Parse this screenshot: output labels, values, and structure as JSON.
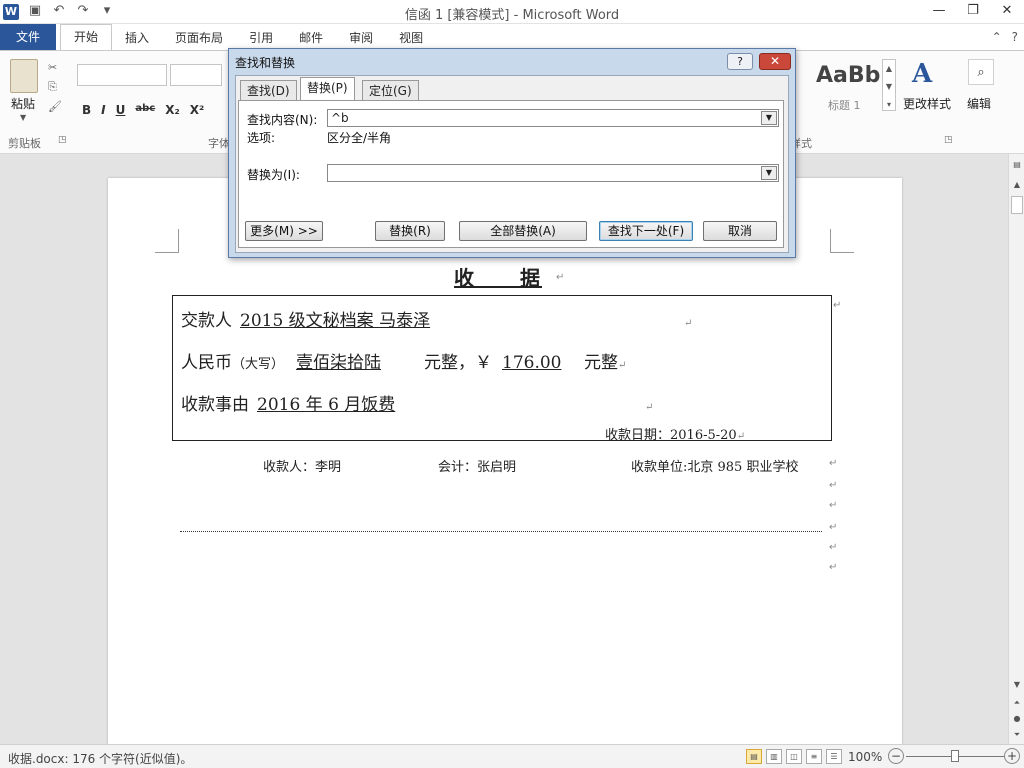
{
  "window": {
    "title": "信函 1 [兼容模式] - Microsoft Word",
    "app_icon": "W"
  },
  "ribbon": {
    "tabs": [
      "文件",
      "开始",
      "插入",
      "页面布局",
      "引用",
      "邮件",
      "审阅",
      "视图"
    ],
    "active_tab": "开始",
    "paste_label": "粘贴",
    "clipboard_group": "剪贴板",
    "font_group": "字体",
    "styles_group": "样式",
    "format_buttons": [
      "B",
      "I",
      "U",
      "abc",
      "X₂",
      "X²"
    ],
    "style_preview": "AaBb",
    "style_name": "标题 1",
    "change_styles_label": "更改样式",
    "edit_label": "编辑"
  },
  "dialog": {
    "title": "查找和替换",
    "help": "?",
    "close": "✕",
    "tabs": [
      "查找(D)",
      "替换(P)",
      "定位(G)"
    ],
    "active_tab": "替换(P)",
    "find_label": "查找内容(N):",
    "find_value": "^b",
    "options_label": "选项:",
    "options_value": "区分全/半角",
    "replace_label": "替换为(I):",
    "replace_value": "",
    "buttons": {
      "more": "更多(M) >>",
      "replace": "替换(R)",
      "replace_all": "全部替换(A)",
      "find_next": "查找下一处(F)",
      "cancel": "取消"
    }
  },
  "document": {
    "title": "收　　据",
    "line1_label": "交款人",
    "line1_value": "2015 级文秘档案  马泰泽",
    "line2_label": "人民币",
    "line2_paren": "（大写）",
    "line2_value": "壹佰柒拾陆",
    "line2_mid": "元整，￥",
    "line2_amount": "176.00",
    "line2_end": "元整",
    "line3_label": "收款事由",
    "line3_value": "2016 年 6 月饭费",
    "date": "收款日期：2016-5-20",
    "payee": "收款人：李明",
    "accountant": "会计：张启明",
    "unit": "收款单位:北京 985 职业学校",
    "para_mark": "↵"
  },
  "status": {
    "text": "收据.docx: 176 个字符(近似值)。",
    "zoom": "100%"
  }
}
